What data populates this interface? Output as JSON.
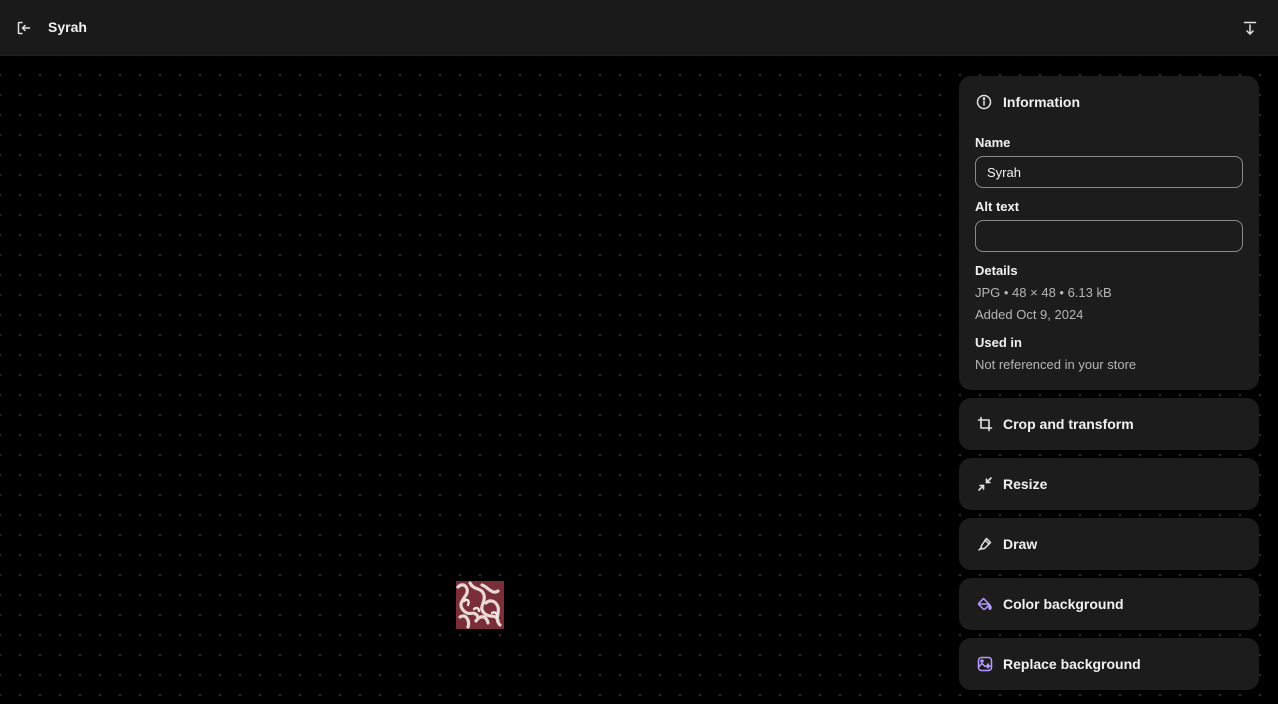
{
  "header": {
    "title": "Syrah",
    "exit_icon": "exit-icon",
    "download_icon": "download-icon"
  },
  "information": {
    "heading": "Information",
    "name_label": "Name",
    "name_value": "Syrah",
    "alt_label": "Alt text",
    "alt_value": "",
    "details_label": "Details",
    "details_line1": "JPG • 48 × 48 • 6.13 kB",
    "details_line2": "Added Oct 9, 2024",
    "used_in_label": "Used in",
    "used_in_value": "Not referenced in your store"
  },
  "tools": [
    {
      "label": "Crop and transform",
      "icon": "crop-icon"
    },
    {
      "label": "Resize",
      "icon": "resize-icon"
    },
    {
      "label": "Draw",
      "icon": "pen-icon"
    },
    {
      "label": "Color background",
      "icon": "paint-bucket-icon"
    },
    {
      "label": "Replace background",
      "icon": "replace-image-icon"
    }
  ],
  "colors": {
    "topbar": "#1a1a1a",
    "canvas": "#000000",
    "panel": "#1c1c1c",
    "ai_accent": "#b69cff",
    "thumbnail": "#7a2e38"
  }
}
